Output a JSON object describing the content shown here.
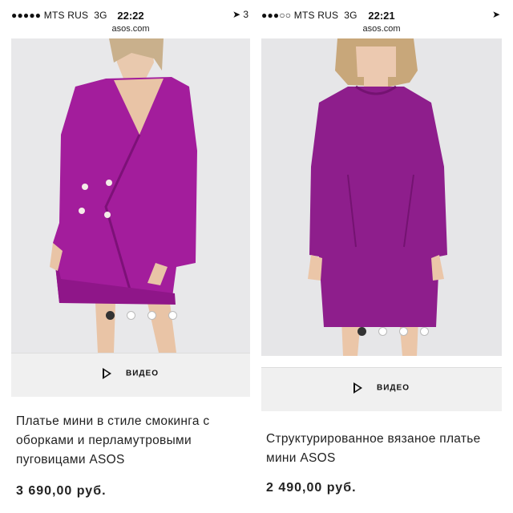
{
  "left": {
    "status": {
      "carrier": "●●●●● MTS RUS",
      "network": "3G",
      "time": "22:22",
      "location": "➤ 3"
    },
    "url": "asos.com",
    "gallery": {
      "count": 4,
      "active": 1
    },
    "video_label": "ВИДЕО",
    "product_title": "Платье мини в стиле смокинга с оборками и перламутровыми пуговицами ASOS",
    "price": "3 690,00 руб."
  },
  "right": {
    "status": {
      "carrier": "●●●○○ MTS RUS",
      "network": "3G",
      "time": "22:21",
      "location": "➤"
    },
    "url": "asos.com",
    "gallery": {
      "count": 4,
      "active": 1
    },
    "video_label": "ВИДЕО",
    "product_title": "Структурированное вязаное платье мини ASOS",
    "price": "2 490,00 руб."
  },
  "colors": {
    "dress_left": "#a31d9c",
    "dress_right": "#8e1e8c",
    "photo_bg": "#e7e7e9"
  }
}
